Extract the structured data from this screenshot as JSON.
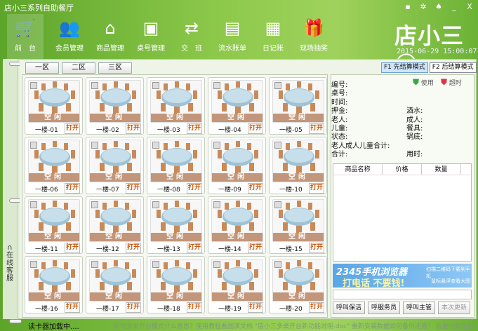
{
  "window": {
    "title": "店小三系列自助餐厅",
    "buttons": [
      {
        "icon": "message-icon",
        "glyph": "▪"
      },
      {
        "icon": "gear-icon",
        "glyph": "✲"
      },
      {
        "icon": "shirt-icon",
        "glyph": "♠"
      },
      {
        "icon": "minimize-icon",
        "glyph": "_"
      },
      {
        "icon": "close-icon",
        "glyph": "X"
      }
    ]
  },
  "toolbar": [
    {
      "label": "前　台",
      "icon": "cart-icon",
      "active": true
    },
    {
      "label": "会员管理",
      "icon": "members-icon"
    },
    {
      "label": "商品管理",
      "icon": "warehouse-icon"
    },
    {
      "label": "桌号管理",
      "icon": "table-number-icon"
    },
    {
      "label": "交　班",
      "icon": "shift-change-icon"
    },
    {
      "label": "流水账单",
      "icon": "bill-icon"
    },
    {
      "label": "日记账",
      "icon": "journal-icon"
    },
    {
      "label": "现场抽奖",
      "icon": "gift-icon"
    }
  ],
  "brand": {
    "logo": "店小三",
    "datetime": "2015-06-29 15:00:07"
  },
  "sidebar": {
    "label": "在线客服",
    "icon": "headset-icon"
  },
  "zones": [
    "一区",
    "二区",
    "三区"
  ],
  "modes": [
    {
      "label": "F1 先结算模式",
      "active": true
    },
    {
      "label": "F2 后结算模式",
      "active": false
    }
  ],
  "tables": {
    "status": "空闲",
    "open_label": "打开",
    "names": [
      "一楼-01",
      "一楼-02",
      "一楼-03",
      "一楼-04",
      "一楼-05",
      "一楼-06",
      "一楼-07",
      "一楼-08",
      "一楼-09",
      "一楼-10",
      "一楼-11",
      "一楼-12",
      "一楼-13",
      "一楼-14",
      "一楼-15",
      "一楼-16",
      "一楼-17",
      "一楼-18",
      "一楼-19",
      "一楼-20"
    ],
    "status_color": "#c2967a"
  },
  "info": {
    "legend_used": "使用",
    "legend_overtime": "超时",
    "used_color": "#3aa648",
    "overtime_color": "#e0334a",
    "left_fields": [
      "编号:",
      "桌号:",
      "时间:",
      "押金:",
      "老人:",
      "儿童:",
      "状态:",
      "老人成人儿童合计:",
      "合计:"
    ],
    "right_fields": [
      "酒水:",
      "成人:",
      "餐具:",
      "锅底:",
      "用时:"
    ]
  },
  "goods_table": {
    "columns": [
      "商品名称",
      "价格",
      "数量"
    ]
  },
  "ad": {
    "title": "2345手机浏览器",
    "slogan": "打电话 不要钱!",
    "note1": "扫描二维码下载到手机",
    "note2": "鼠标悬浮查看大图"
  },
  "calls": [
    {
      "label": "呼叫保洁"
    },
    {
      "label": "呼服务员"
    },
    {
      "label": "呼叫主管"
    },
    {
      "label": "本次更新",
      "disabled": true
    }
  ],
  "statusbar": {
    "text": "读卡器加载中....",
    "ticker": "新增多桌开台模式什么意思？使用教程看图演文档  \"店小三多桌开台新功能说明.doc\"  重新安装数据如何备份还原？ 我要付费定制功能！"
  }
}
